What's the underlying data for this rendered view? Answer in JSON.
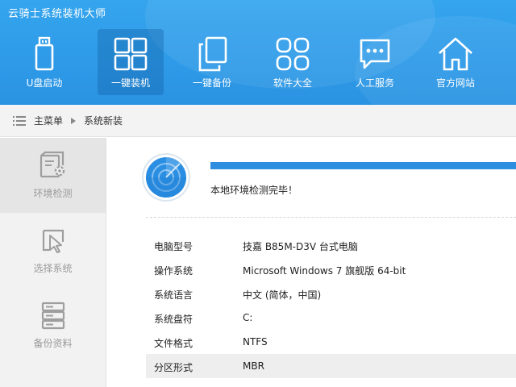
{
  "app": {
    "title": "云骑士系统装机大师"
  },
  "nav": {
    "items": [
      {
        "label": "U盘启动",
        "icon": "usb-drive-icon"
      },
      {
        "label": "一键装机",
        "icon": "windows-logo-icon",
        "active": true
      },
      {
        "label": "一键备份",
        "icon": "backup-copy-icon"
      },
      {
        "label": "软件大全",
        "icon": "app-grid-icon"
      },
      {
        "label": "人工服务",
        "icon": "chat-bubble-icon"
      },
      {
        "label": "官方网站",
        "icon": "home-icon"
      }
    ]
  },
  "breadcrumb": {
    "home": "主菜单",
    "current": "系统新装"
  },
  "sidebar": {
    "items": [
      {
        "label": "环境检测",
        "icon": "environment-check-icon",
        "active": true
      },
      {
        "label": "选择系统",
        "icon": "cursor-select-icon"
      },
      {
        "label": "备份资料",
        "icon": "server-stack-icon"
      }
    ]
  },
  "detection": {
    "status": "本地环境检测完毕！",
    "progress": 1.0
  },
  "info": {
    "rows": [
      {
        "key": "电脑型号",
        "value": "技嘉 B85M-D3V 台式电脑"
      },
      {
        "key": "操作系统",
        "value": "Microsoft Windows 7 旗舰版  64-bit"
      },
      {
        "key": "系统语言",
        "value": "中文 (简体，中国)"
      },
      {
        "key": "系统盘符",
        "value": "C:"
      },
      {
        "key": "文件格式",
        "value": "NTFS"
      },
      {
        "key": "分区形式",
        "value": "MBR"
      }
    ]
  },
  "colors": {
    "header": "#2e9ae8",
    "accent": "#2e8ee0",
    "sidebar": "#f2f2f2"
  }
}
